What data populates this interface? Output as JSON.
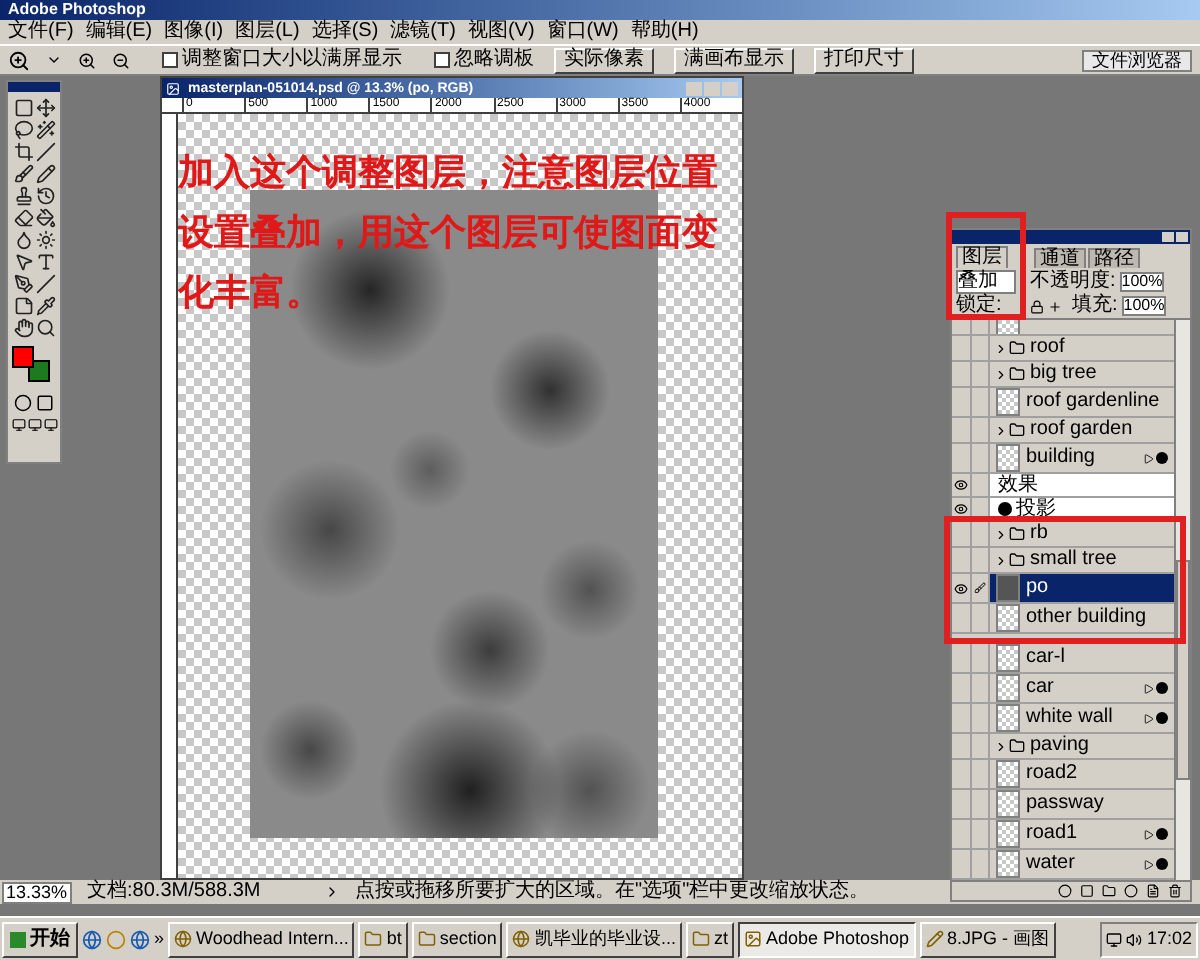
{
  "window": {
    "title": "Adobe Photoshop"
  },
  "menu": [
    "文件(F)",
    "编辑(E)",
    "图像(I)",
    "图层(L)",
    "选择(S)",
    "滤镜(T)",
    "视图(V)",
    "窗口(W)",
    "帮助(H)"
  ],
  "options_bar": {
    "checkboxes": [
      {
        "label": "调整窗口大小以满屏显示",
        "checked": false
      },
      {
        "label": "忽略调板",
        "checked": false
      }
    ],
    "buttons": [
      "实际像素",
      "满画布显示",
      "打印尺寸"
    ],
    "palette_well": "文件浏览器"
  },
  "toolbox": {
    "swatches": [
      {
        "color": "#ff0000"
      },
      {
        "color": "#1e7a1e"
      }
    ]
  },
  "document": {
    "title": "masterplan-051014.psd @ 13.3% (po, RGB)",
    "ruler_labels": [
      "0",
      "500",
      "1000",
      "1500",
      "2000",
      "2500",
      "3000",
      "3500",
      "4000"
    ],
    "annotation": "加入这个调整图层，注意图层位置设置叠加，用这个图层可使图面变化丰富。"
  },
  "layers_panel": {
    "tabs": [
      {
        "label": "图层",
        "selected": true
      },
      {
        "label": "通道",
        "selected": false
      },
      {
        "label": "路径",
        "selected": false
      }
    ],
    "blend_mode": "叠加",
    "opacity_label": "不透明度:",
    "opacity": "100%",
    "lock_label": "锁定:",
    "fill_label": "填充:",
    "fill": "100%",
    "layers": [
      {
        "kind": "layer",
        "visible": false,
        "selected": false,
        "fx": false
      },
      {
        "kind": "group",
        "name": "roof",
        "visible": false,
        "selected": false,
        "fx": false
      },
      {
        "kind": "group",
        "name": "big tree",
        "visible": false,
        "selected": false,
        "fx": false
      },
      {
        "kind": "layer",
        "name": "roof gardenline",
        "visible": false,
        "selected": false,
        "fx": false
      },
      {
        "kind": "group",
        "name": "roof garden",
        "visible": false,
        "selected": false,
        "fx": false
      },
      {
        "kind": "layer",
        "name": "building",
        "visible": false,
        "selected": false,
        "fx": true
      },
      {
        "kind": "effects",
        "name": "效果",
        "visible": true,
        "selected": false,
        "fx": false
      },
      {
        "kind": "effect",
        "name": "投影",
        "visible": true,
        "selected": false,
        "fx": false
      },
      {
        "kind": "group",
        "name": "rb",
        "visible": false,
        "selected": false,
        "fx": false
      },
      {
        "kind": "group",
        "name": "small tree",
        "visible": false,
        "selected": false,
        "fx": false
      },
      {
        "kind": "layer",
        "name": "po",
        "visible": true,
        "selected": true,
        "fx": false
      },
      {
        "kind": "layer",
        "name": "other building",
        "visible": false,
        "selected": false,
        "fx": false
      },
      {
        "kind": "layer",
        "name": "car-l",
        "visible": false,
        "selected": false,
        "fx": false
      },
      {
        "kind": "layer",
        "name": "car",
        "visible": false,
        "selected": false,
        "fx": true
      },
      {
        "kind": "layer",
        "name": "white wall",
        "visible": false,
        "selected": false,
        "fx": true
      },
      {
        "kind": "group",
        "name": "paving",
        "visible": false,
        "selected": false,
        "fx": false
      },
      {
        "kind": "layer",
        "name": "road2",
        "visible": false,
        "selected": false,
        "fx": false
      },
      {
        "kind": "layer",
        "name": "passway",
        "visible": false,
        "selected": false,
        "fx": false
      },
      {
        "kind": "layer",
        "name": "road1",
        "visible": false,
        "selected": false,
        "fx": true
      },
      {
        "kind": "layer",
        "name": "water",
        "visible": false,
        "selected": false,
        "fx": true
      }
    ]
  },
  "status_bar": {
    "zoom": "13.33%",
    "doc_size": "文档:80.3M/588.3M",
    "hint": "点按或拖移所要扩大的区域。在\"选项\"栏中更改缩放状态。"
  },
  "taskbar": {
    "start": "开始",
    "more": "»",
    "tasks": [
      {
        "label": "Woodhead Intern...",
        "kind": "browser",
        "selected": false
      },
      {
        "label": "bt",
        "kind": "folder",
        "selected": false
      },
      {
        "label": "section",
        "kind": "folder",
        "selected": false
      },
      {
        "label": "凯毕业的毕业设...",
        "kind": "browser",
        "selected": false
      },
      {
        "label": "zt",
        "kind": "folder",
        "selected": false
      },
      {
        "label": "Adobe Photoshop",
        "kind": "app",
        "selected": true
      },
      {
        "label": "8.JPG - 画图",
        "kind": "paint",
        "selected": false
      }
    ],
    "clock": "17:02"
  }
}
